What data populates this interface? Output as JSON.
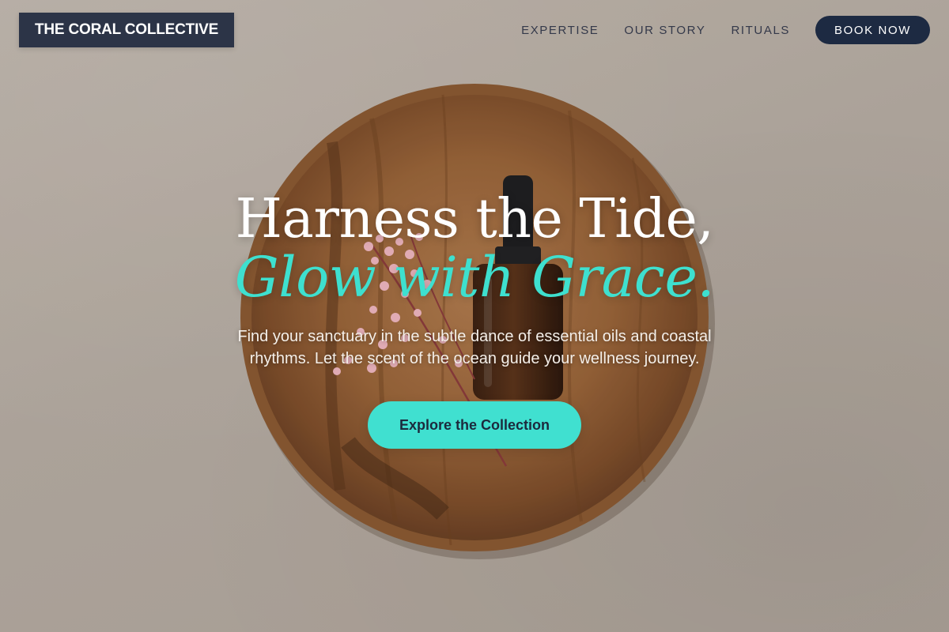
{
  "header": {
    "logo_text": "THE CORAL COLLECTIVE",
    "nav": [
      {
        "label": "EXPERTISE"
      },
      {
        "label": "OUR STORY"
      },
      {
        "label": "RITUALS"
      }
    ],
    "book_label": "BOOK NOW"
  },
  "hero": {
    "headline": "Harness the Tide,",
    "headline_accent": "Glow with Grace.",
    "subtitle": "Find your sanctuary in the subtle dance of essential oils and coastal rhythms. Let the scent of the ocean guide your wellness journey.",
    "cta_label": "Explore the Collection",
    "background_image": "wooden-tray-with-serum-bottle-and-dried-flowers"
  },
  "colors": {
    "logo_bg": "#2c3447",
    "book_bg": "#1d2a42",
    "accent": "#40e0d0",
    "nav_text": "#34394a"
  }
}
